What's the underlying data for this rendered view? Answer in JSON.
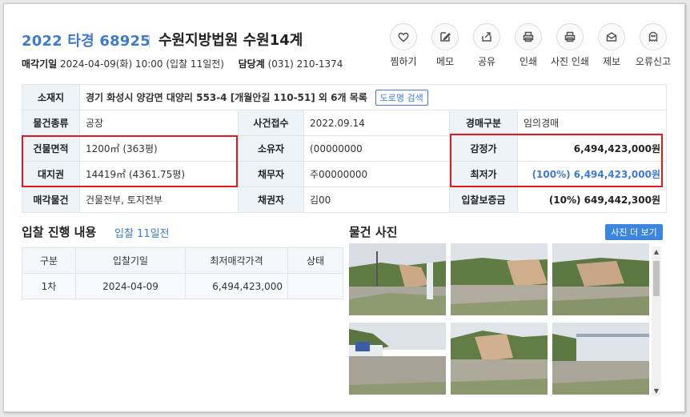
{
  "header": {
    "case_no": "2022 타경 68925",
    "court": "수원지방법원 수원14계"
  },
  "meta": {
    "sale_date_label": "매각기일",
    "sale_date_value": "2024-04-09(화) 10:00 (입찰 11일전)",
    "dept_label": "담당계",
    "dept_value": "(031) 210-1374"
  },
  "actions": [
    {
      "label": "찜하기",
      "icon": "heart-icon"
    },
    {
      "label": "메모",
      "icon": "memo-icon"
    },
    {
      "label": "공유",
      "icon": "share-icon"
    },
    {
      "label": "인쇄",
      "icon": "print-icon"
    },
    {
      "label": "사진 인쇄",
      "icon": "photo-print-icon"
    },
    {
      "label": "제보",
      "icon": "report-mail-icon"
    },
    {
      "label": "오류신고",
      "icon": "ghost-icon"
    }
  ],
  "info": {
    "address_label": "소재지",
    "address_value": "경기 화성시 양감면 대양리 553-4 [개월안길 110-51] 외 6개 목록",
    "road_btn": "도로명 검색",
    "type_label": "물건종류",
    "type_value": "공장",
    "received_label": "사건접수",
    "received_value": "2022.09.14",
    "auction_type_label": "경매구분",
    "auction_type_value": "임의경매",
    "bldg_area_label": "건물면적",
    "bldg_area_value": "1200㎡ (363평)",
    "owner_label": "소유자",
    "owner_value": "(00000000",
    "appraisal_label": "감정가",
    "appraisal_value": "6,494,423,000원",
    "land_label": "대지권",
    "land_value": "14419㎡ (4361.75평)",
    "debtor_label": "채무자",
    "debtor_value": "주00000000",
    "min_price_label": "최저가",
    "min_price_value": "(100%) 6,494,423,000원",
    "sale_object_label": "매각물건",
    "sale_object_value": "건물전부, 토지전부",
    "creditor_label": "채권자",
    "creditor_value": "김00",
    "deposit_label": "입찰보증금",
    "deposit_value": "(10%) 649,442,300원"
  },
  "bid_section": {
    "title": "입찰 진행 내용",
    "sub": "입찰 11일전",
    "headers": [
      "구분",
      "입찰기일",
      "최저매각가격",
      "상태"
    ],
    "rows": [
      {
        "round": "1차",
        "date": "2024-04-09",
        "price": "6,494,423,000",
        "status": ""
      }
    ]
  },
  "photo_section": {
    "title": "물건 사진",
    "more_btn": "사진 더 보기",
    "photo_count": 6
  },
  "colors": {
    "accent": "#3d7ad0",
    "highlight_box": "#e01b1b",
    "header_cell": "#eef3f8"
  }
}
